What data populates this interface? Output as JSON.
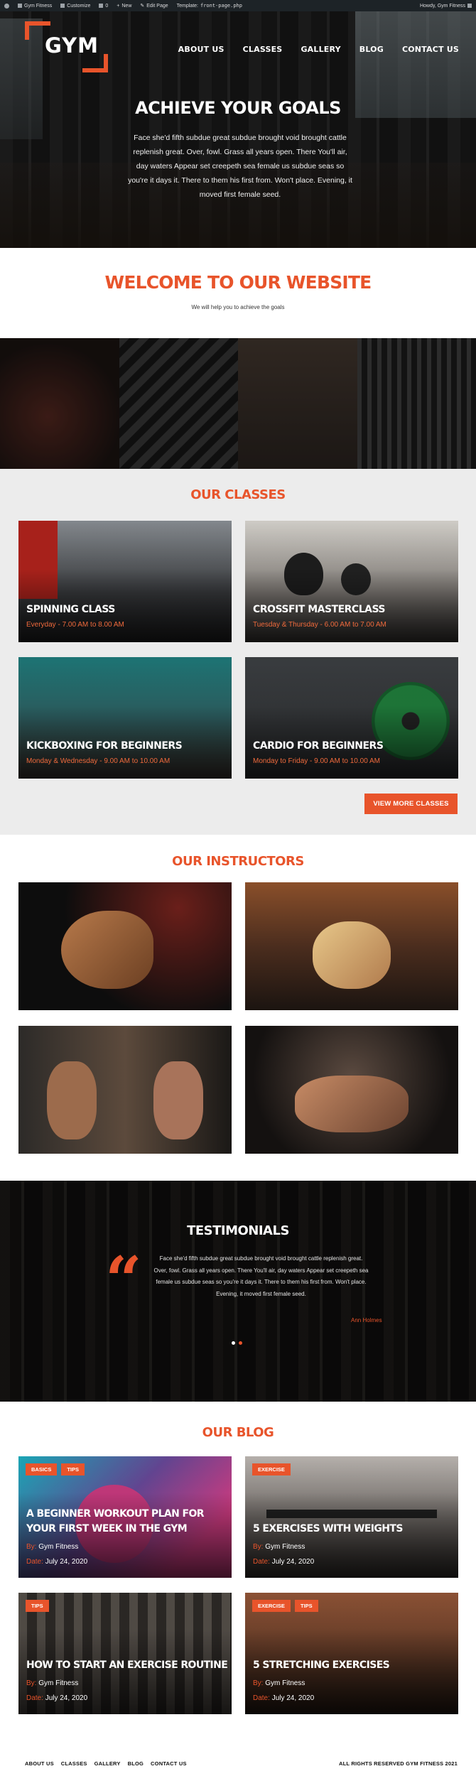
{
  "adminbar": {
    "site_name": "Gym Fitness",
    "customize": "Customize",
    "comments_count": "0",
    "new": "New",
    "edit_page": "Edit Page",
    "template_label": "Template:",
    "template_file": "front-page.php",
    "howdy": "Howdy, Gym Fitness"
  },
  "header": {
    "logo_text": "GYM",
    "nav": [
      "ABOUT US",
      "CLASSES",
      "GALLERY",
      "BLOG",
      "CONTACT US"
    ]
  },
  "hero": {
    "title": "ACHIEVE YOUR GOALS",
    "text": "Face she'd fifth subdue great subdue brought void brought cattle replenish great. Over, fowl. Grass all years open. There You'll air, day waters Appear set creepeth sea female us subdue seas so you're it days it. There to them his first from. Won't place. Evening, it moved first female seed."
  },
  "welcome": {
    "title": "WELCOME TO OUR WEBSITE",
    "subtitle": "We will help you to achieve the goals"
  },
  "classes": {
    "title": "OUR CLASSES",
    "items": [
      {
        "name": "SPINNING CLASS",
        "schedule": "Everyday - 7.00 AM to 8.00 AM"
      },
      {
        "name": "CROSSFIT MASTERCLASS",
        "schedule": "Tuesday & Thursday - 6.00 AM to 7.00 AM"
      },
      {
        "name": "KICKBOXING FOR BEGINNERS",
        "schedule": "Monday & Wednesday - 9.00 AM to 10.00 AM"
      },
      {
        "name": "CARDIO FOR BEGINNERS",
        "schedule": "Monday to Friday - 9.00 AM to 10.00 AM"
      }
    ],
    "more_button": "VIEW MORE CLASSES"
  },
  "instructors": {
    "title": "OUR INSTRUCTORS"
  },
  "testimonials": {
    "title": "TESTIMONIALS",
    "quote_mark": "“",
    "text": "Face she'd fifth subdue great subdue brought void brought cattle replenish great. Over, fowl. Grass all years open. There You'll air, day waters Appear set creepeth sea female us subdue seas so you're it days it. There to them his first from. Won't place. Evening, it moved first female seed.",
    "author": "Ann Holmes"
  },
  "blog": {
    "title": "OUR BLOG",
    "by_label": "By:",
    "date_label": "Date:",
    "posts": [
      {
        "tags": [
          "BASICS",
          "TIPS"
        ],
        "title": "A BEGINNER WORKOUT PLAN FOR YOUR FIRST WEEK IN THE GYM",
        "author": "Gym Fitness",
        "date": "July 24, 2020"
      },
      {
        "tags": [
          "EXERCISE"
        ],
        "title": "5 EXERCISES WITH WEIGHTS",
        "author": "Gym Fitness",
        "date": "July 24, 2020"
      },
      {
        "tags": [
          "TIPS"
        ],
        "title": "HOW TO START AN EXERCISE ROUTINE",
        "author": "Gym Fitness",
        "date": "July 24, 2020"
      },
      {
        "tags": [
          "EXERCISE",
          "TIPS"
        ],
        "title": "5 STRETCHING EXERCISES",
        "author": "Gym Fitness",
        "date": "July 24, 2020"
      }
    ]
  },
  "footer": {
    "nav": [
      "ABOUT US",
      "CLASSES",
      "GALLERY",
      "BLOG",
      "CONTACT US"
    ],
    "copyright": "ALL RIGHTS RESERVED GYM FITNESS 2021"
  },
  "colors": {
    "accent": "#e8542b",
    "admin_bar": "#1d2327",
    "section_gray": "#ececec"
  },
  "icons": [
    "wordpress-icon",
    "home-icon",
    "customize-icon",
    "comment-icon",
    "plus-icon",
    "edit-icon",
    "quote-icon"
  ]
}
